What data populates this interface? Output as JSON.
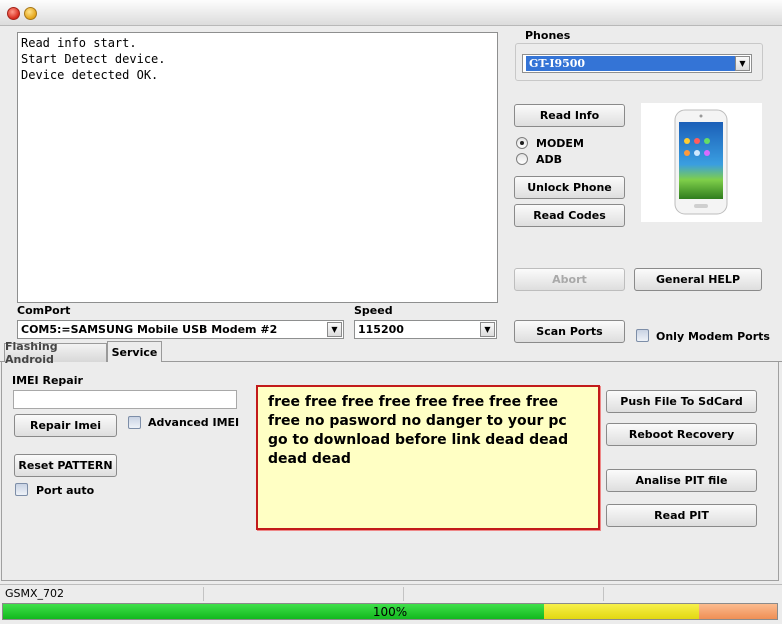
{
  "log": {
    "lines": [
      "Read info start.",
      "Start Detect device.",
      "Device detected OK."
    ]
  },
  "phones": {
    "legend": "Phones",
    "selected": "GT-I9500"
  },
  "buttons": {
    "read_info": "Read Info",
    "unlock_phone": "Unlock Phone",
    "read_codes": "Read Codes",
    "abort": "Abort",
    "general_help": "General HELP",
    "scan_ports": "Scan Ports",
    "repair_imei": "Repair Imei",
    "reset_pattern": "Reset PATTERN",
    "push_file": "Push File To SdCard",
    "reboot_recovery": "Reboot Recovery",
    "analise_pit": "Analise PIT file",
    "read_pit": "Read PIT"
  },
  "mode": {
    "options": [
      "MODEM",
      "ADB"
    ],
    "selected": "MODEM"
  },
  "comport": {
    "label": "ComPort",
    "value": "COM5:=SAMSUNG Mobile USB Modem #2"
  },
  "speed": {
    "label": "Speed",
    "value": "115200"
  },
  "only_modem_ports": "Only Modem Ports",
  "tabs": [
    "Flashing Android",
    "Service"
  ],
  "active_tab": "Service",
  "service": {
    "imei_label": "IMEI Repair",
    "imei_value": "",
    "advanced_imei": "Advanced IMEI",
    "port_auto": "Port auto"
  },
  "note_text": "free free free free free free free free free no pasword no danger to your pc go to download before link dead dead dead dead",
  "status": {
    "app_name": "GSMX_702"
  },
  "progress": {
    "value": 100,
    "label": "100%"
  },
  "colors": {
    "selection": "#3474d6",
    "note_border": "#c21a1a",
    "note_bg": "#ffffc4",
    "progress_green": "#22d22e",
    "progress_yellow": "#f2ea1e",
    "progress_orange": "#f8a46e"
  }
}
